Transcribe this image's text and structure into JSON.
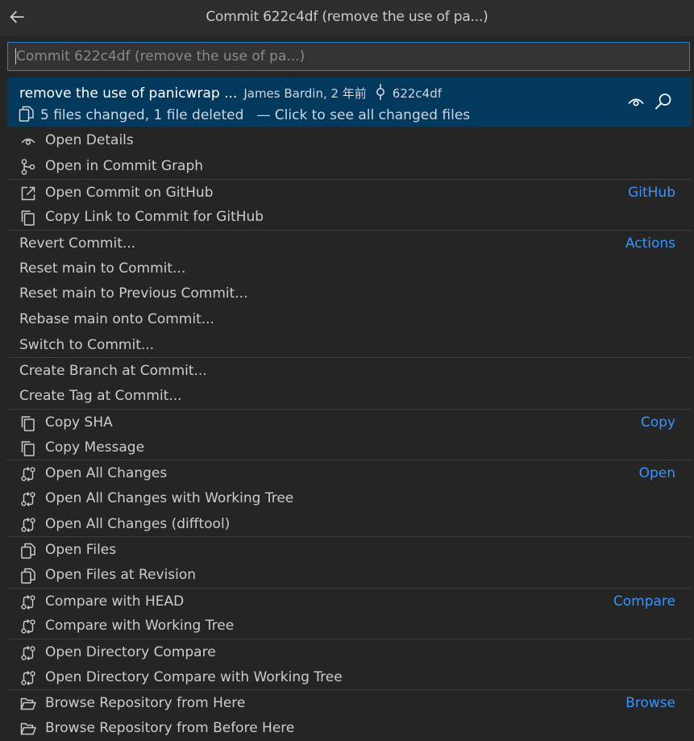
{
  "window": {
    "title": "Commit 622c4df (remove the use of pa...)"
  },
  "input": {
    "placeholder": "Commit 622c4df (remove the use of pa...)",
    "value": ""
  },
  "selected": {
    "message": "remove the use of panicwrap ...",
    "meta": "James Bardin, 2 年前",
    "sha": "622c4df",
    "files_summary": "5 files changed, 1 file deleted",
    "hint": "— Click to see all changed files"
  },
  "items": [
    {
      "label": "Open Details",
      "icon": "eye-icon",
      "group": ""
    },
    {
      "label": "Open in Commit Graph",
      "icon": "git-graph-icon",
      "group": ""
    },
    {
      "label": "Open Commit on GitHub",
      "icon": "link-external-icon",
      "group": "GitHub"
    },
    {
      "label": "Copy Link to Commit for GitHub",
      "icon": "copy-icon",
      "group": ""
    },
    {
      "label": "Revert Commit...",
      "icon": "",
      "group": "Actions"
    },
    {
      "label": "Reset main to Commit...",
      "icon": "",
      "group": ""
    },
    {
      "label": "Reset main to Previous Commit...",
      "icon": "",
      "group": ""
    },
    {
      "label": "Rebase main onto Commit...",
      "icon": "",
      "group": ""
    },
    {
      "label": "Switch to Commit...",
      "icon": "",
      "group": ""
    },
    {
      "label": "Create Branch at Commit...",
      "icon": "",
      "group": ""
    },
    {
      "label": "Create Tag at Commit...",
      "icon": "",
      "group": ""
    },
    {
      "label": "Copy SHA",
      "icon": "copy-icon",
      "group": "Copy"
    },
    {
      "label": "Copy Message",
      "icon": "copy-icon",
      "group": ""
    },
    {
      "label": "Open All Changes",
      "icon": "compare-changes-icon",
      "group": "Open"
    },
    {
      "label": "Open All Changes with Working Tree",
      "icon": "compare-changes-icon",
      "group": ""
    },
    {
      "label": "Open All Changes (difftool)",
      "icon": "compare-changes-icon",
      "group": ""
    },
    {
      "label": "Open Files",
      "icon": "files-icon",
      "group": ""
    },
    {
      "label": "Open Files at Revision",
      "icon": "files-icon",
      "group": ""
    },
    {
      "label": "Compare with HEAD",
      "icon": "compare-changes-icon",
      "group": "Compare"
    },
    {
      "label": "Compare with Working Tree",
      "icon": "compare-changes-icon",
      "group": ""
    },
    {
      "label": "Open Directory Compare",
      "icon": "compare-changes-icon",
      "group": ""
    },
    {
      "label": "Open Directory Compare with Working Tree",
      "icon": "compare-changes-icon",
      "group": ""
    },
    {
      "label": "Browse Repository from Here",
      "icon": "folder-opened-icon",
      "group": "Browse"
    },
    {
      "label": "Browse Repository from Before Here",
      "icon": "folder-opened-icon",
      "group": ""
    }
  ],
  "colors": {
    "accent": "#3794ff",
    "selection": "#04395e",
    "focus_border": "#2f7fd3",
    "background": "#252526"
  }
}
